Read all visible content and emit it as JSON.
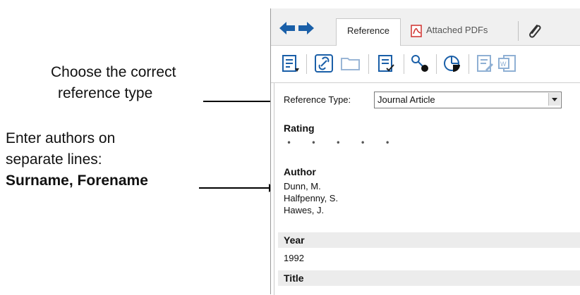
{
  "annotations": {
    "ref_type_line1": "Choose the correct",
    "ref_type_line2": "reference type",
    "authors_line1": "Enter authors on",
    "authors_line2": "separate lines:",
    "authors_line3": "Surname, Forename"
  },
  "tabs": {
    "reference": "Reference",
    "attached_pdfs": "Attached PDFs"
  },
  "icons": {
    "back": "arrow-left-icon",
    "forward": "arrow-right-icon",
    "pdf": "pdf-icon",
    "attach": "paperclip-icon",
    "toolbar": [
      "insert-citation-icon",
      "link-icon",
      "folder-icon",
      "format-icon",
      "find-fulltext-icon",
      "chart-icon",
      "edit-icon",
      "word-icon"
    ]
  },
  "form": {
    "reference_type_label": "Reference Type:",
    "reference_type_value": "Journal Article",
    "rating_label": "Rating",
    "rating_dots": "• • • • •",
    "author_label": "Author",
    "authors": [
      "Dunn, M.",
      "Halfpenny, S.",
      "Hawes, J."
    ],
    "year_label": "Year",
    "year_value": "1992",
    "title_label": "Title"
  },
  "colors": {
    "accent_blue": "#1a5fa8",
    "pdf_red": "#d0312d"
  }
}
